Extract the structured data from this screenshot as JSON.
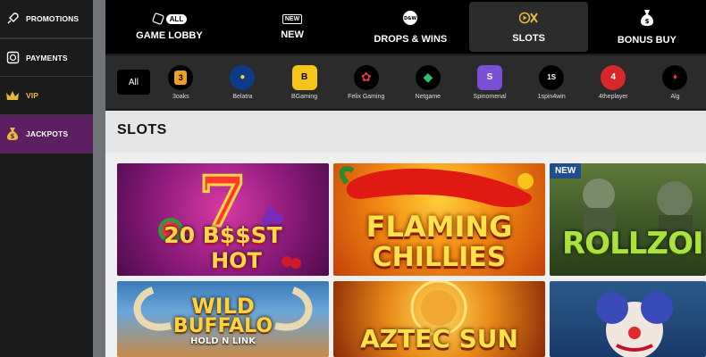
{
  "sidebar": {
    "items": [
      {
        "label": "PROMOTIONS",
        "icon": "rocket-icon"
      },
      {
        "label": "PAYMENTS",
        "icon": "safe-icon"
      },
      {
        "label": "VIP",
        "icon": "crown-icon"
      },
      {
        "label": "JACKPOTS",
        "icon": "moneybag-icon"
      }
    ]
  },
  "nav": {
    "items": [
      {
        "label": "GAME LOBBY",
        "icon_text": "ALL"
      },
      {
        "label": "NEW",
        "icon_text": "NEW"
      },
      {
        "label": "DROPS & WINS"
      },
      {
        "label": "SLOTS"
      },
      {
        "label": "BONUS BUY"
      }
    ]
  },
  "providers": {
    "all_label": "All",
    "items": [
      {
        "name": "3oaks",
        "glyph": "3"
      },
      {
        "name": "Belatra",
        "glyph": "●"
      },
      {
        "name": "BGaming",
        "glyph": "B"
      },
      {
        "name": "Felix Gaming",
        "glyph": "✿"
      },
      {
        "name": "Netgame",
        "glyph": "◆"
      },
      {
        "name": "Spinomenal",
        "glyph": "S"
      },
      {
        "name": "1spin4win",
        "glyph": "1S"
      },
      {
        "name": "4theplayer",
        "glyph": "4"
      },
      {
        "name": "Alg",
        "glyph": "♦"
      }
    ]
  },
  "main": {
    "title": "SLOTS",
    "games": [
      {
        "title_line1": "20 B$$ST",
        "title_line2": "HOT"
      },
      {
        "title_line1": "FLAMING",
        "title_line2": "CHILLIES"
      },
      {
        "title_line1": "ROLLZOI",
        "badge": "NEW"
      },
      {
        "title_line1": "WILD",
        "title_line2": "BUFFALO",
        "title_line3": "HOLD N LINK"
      },
      {
        "title_line1": "AZTEC SUN"
      },
      {
        "title_line1": ""
      }
    ]
  },
  "colors": {
    "accent_purple": "#5b1f62",
    "vip_gold": "#e8b83c",
    "new_badge": "#1f4e8f"
  }
}
